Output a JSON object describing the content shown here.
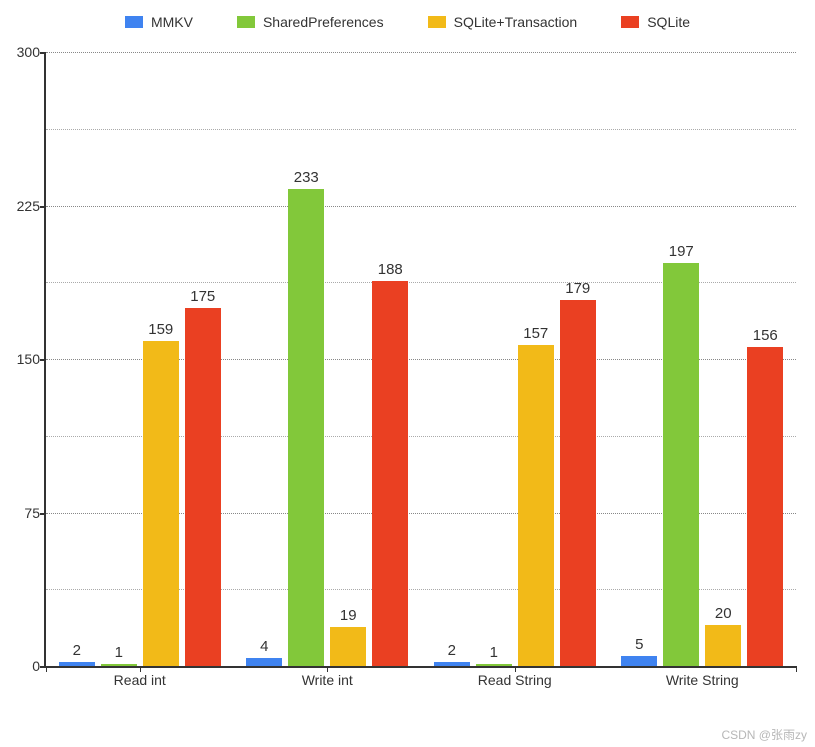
{
  "chart_data": {
    "type": "bar",
    "title": "",
    "xlabel": "",
    "ylabel": "",
    "ylim": [
      0,
      300
    ],
    "y_ticks": [
      0,
      75,
      150,
      225,
      300
    ],
    "categories": [
      "Read int",
      "Write int",
      "Read String",
      "Write String"
    ],
    "series": [
      {
        "name": "MMKV",
        "color": "#3f83f0",
        "values": [
          2,
          4,
          2,
          5
        ]
      },
      {
        "name": "SharedPreferences",
        "color": "#82c83a",
        "values": [
          1,
          233,
          1,
          197
        ]
      },
      {
        "name": "SQLite+Transaction",
        "color": "#f2ba18",
        "values": [
          159,
          19,
          157,
          20
        ]
      },
      {
        "name": "SQLite",
        "color": "#ea4022",
        "values": [
          175,
          188,
          179,
          156
        ]
      }
    ]
  },
  "legend": {
    "items": [
      "MMKV",
      "SharedPreferences",
      "SQLite+Transaction",
      "SQLite"
    ]
  },
  "watermark": "CSDN @张雨zy"
}
